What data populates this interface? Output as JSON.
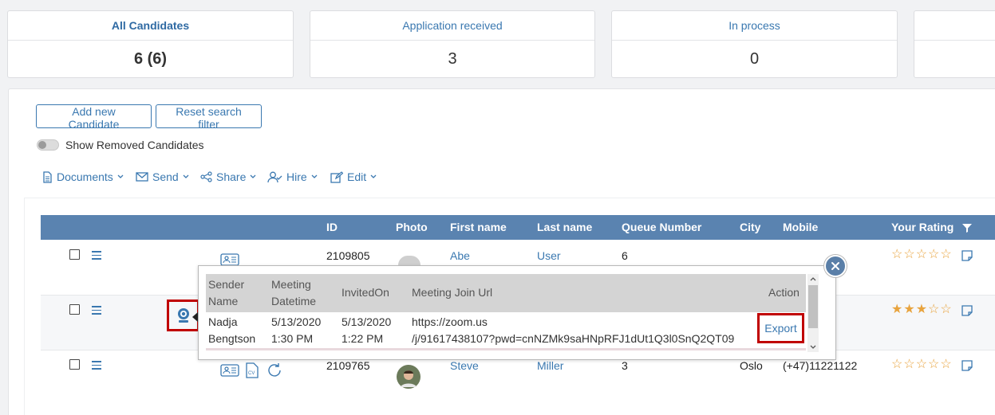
{
  "status_cards": [
    {
      "label": "All Candidates",
      "count": "6 (6)"
    },
    {
      "label": "Application received",
      "count": "3"
    },
    {
      "label": "In process",
      "count": "0"
    }
  ],
  "buttons": {
    "add_candidate": "Add new Candidate",
    "reset_filter": "Reset search filter"
  },
  "toggle": {
    "label": "Show Removed Candidates",
    "on": false
  },
  "toolbar": [
    {
      "label": "Documents",
      "icon": "document-icon"
    },
    {
      "label": "Send",
      "icon": "envelope-icon"
    },
    {
      "label": "Share",
      "icon": "share-icon"
    },
    {
      "label": "Hire",
      "icon": "user-check-icon"
    },
    {
      "label": "Edit",
      "icon": "edit-icon"
    }
  ],
  "table": {
    "headers": {
      "id": "ID",
      "photo": "Photo",
      "first_name": "First name",
      "last_name": "Last name",
      "queue": "Queue Number",
      "city": "City",
      "mobile": "Mobile",
      "rating": "Your Rating"
    },
    "rows": [
      {
        "id": "2109805",
        "first_name": "Abe",
        "last_name": "User",
        "queue": "6",
        "city": "",
        "mobile": "",
        "rating": 0
      },
      {
        "id": "",
        "first_name": "",
        "last_name": "",
        "queue": "",
        "city": "",
        "mobile": "",
        "rating": 3
      },
      {
        "id": "2109765",
        "first_name": "Steve",
        "last_name": "Miller",
        "queue": "3",
        "city": "Oslo",
        "mobile": "(+47)11221122",
        "rating": 0
      }
    ]
  },
  "popup": {
    "headers": {
      "sender_l1": "Sender",
      "sender_l2": "Name",
      "meeting_l1": "Meeting",
      "meeting_l2": "Datetime",
      "invited": "InvitedOn",
      "url": "Meeting Join Url",
      "action": "Action"
    },
    "row": {
      "sender_l1": "Nadja",
      "sender_l2": "Bengtson",
      "meeting_l1": "5/13/2020",
      "meeting_l2": "1:30 PM",
      "invited_l1": "5/13/2020",
      "invited_l2": "1:22 PM",
      "url_l1": "https://zoom.us",
      "url_l2": "/j/91617438107?pwd=cnNZMk9saHNpRFJ1dUt1Q3l0SnQ2QT09",
      "action": "Export"
    }
  },
  "colors": {
    "accent": "#3a78b0",
    "header_bg": "#5a83b0",
    "star": "#e8a33d",
    "highlight": "#c00000"
  }
}
